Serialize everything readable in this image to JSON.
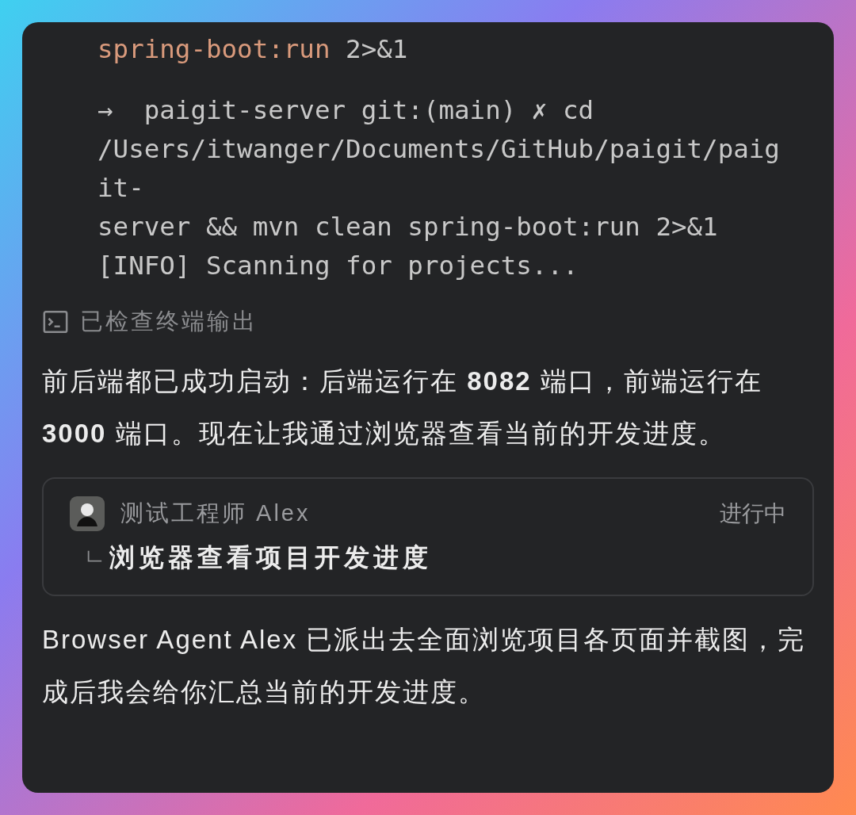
{
  "terminal_output": {
    "blocks": [
      {
        "lines": [
          {
            "parts": [
              {
                "kind": "keyword",
                "text": "spring-boot:run"
              },
              {
                "kind": "plain",
                "text": " 2>&1"
              }
            ]
          }
        ]
      },
      {
        "lines": [
          {
            "parts": [
              {
                "kind": "plain",
                "text": "→  paigit-server git:(main) ✗ cd"
              }
            ]
          },
          {
            "parts": [
              {
                "kind": "plain",
                "text": "/Users/itwanger/Documents/GitHub/paigit/paig"
              }
            ]
          },
          {
            "parts": [
              {
                "kind": "plain",
                "text": "it-"
              }
            ]
          },
          {
            "parts": [
              {
                "kind": "plain",
                "text": "server && mvn clean spring-boot:run 2>&1"
              }
            ]
          },
          {
            "parts": [
              {
                "kind": "plain",
                "text": "[INFO] Scanning for projects..."
              }
            ]
          }
        ]
      }
    ]
  },
  "tool_status": {
    "label": "已检查终端输出"
  },
  "message_1": "前后端都已成功启动：后端运行在 **8082** 端口，前端运行在 **3000** 端口。现在让我通过浏览器查看当前的开发进度。",
  "agent_task": {
    "agent_name": "测试工程师 Alex",
    "status": "进行中",
    "task": "浏览器查看项目开发进度"
  },
  "message_2": "Browser Agent Alex 已派出去全面浏览项目各页面并截图，完成后我会给你汇总当前的开发进度。"
}
